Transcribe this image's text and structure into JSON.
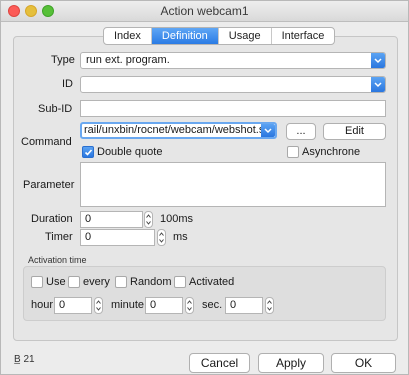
{
  "window": {
    "title": "Action webcam1"
  },
  "tabs": [
    {
      "label": "Index",
      "active": false
    },
    {
      "label": "Definition",
      "active": true
    },
    {
      "label": "Usage",
      "active": false
    },
    {
      "label": "Interface",
      "active": false
    }
  ],
  "form": {
    "type_label": "Type",
    "type_value": "run ext. program.",
    "id_label": "ID",
    "id_value": "",
    "subid_label": "Sub-ID",
    "subid_value": "",
    "command_label": "Command",
    "command_value": "rail/unxbin/rocnet/webcam/webshot.sh",
    "browse_label": "...",
    "edit_label": "Edit",
    "double_quote_label": "Double quote",
    "double_quote_checked": true,
    "asynchrone_label": "Asynchrone",
    "asynchrone_checked": false,
    "parameter_label": "Parameter",
    "parameter_value": "",
    "duration_label": "Duration",
    "duration_value": "0",
    "duration_unit": "100ms",
    "timer_label": "Timer",
    "timer_value": "0",
    "timer_unit": "ms"
  },
  "activation": {
    "title": "Activation time",
    "use_label": "Use",
    "every_label": "every",
    "random_label": "Random",
    "activated_label": "Activated",
    "hour_label": "hour",
    "hour_value": "0",
    "minute_label": "minute",
    "minute_value": "0",
    "sec_label": "sec.",
    "sec_value": "0"
  },
  "footer": {
    "status_text": "B̲ 21",
    "cancel_label": "Cancel",
    "apply_label": "Apply",
    "ok_label": "OK"
  },
  "colors": {
    "accent": "#2a7be4",
    "close": "#fc5b57",
    "minimize": "#e5bf3c",
    "maximize": "#57c038"
  }
}
